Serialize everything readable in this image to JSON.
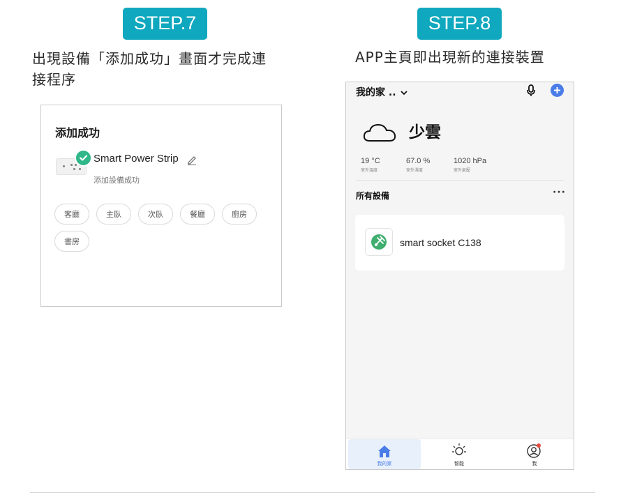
{
  "step7": {
    "badge": "STEP.7",
    "desc_line1": "出現設備「添加成功」畫面才完成連",
    "desc_line2": "接程序",
    "card": {
      "title": "添加成功",
      "device_name": "Smart Power Strip",
      "status": "添加設備成功",
      "rooms": [
        "客廳",
        "主臥",
        "次臥",
        "餐廳",
        "廚房",
        "書房"
      ]
    }
  },
  "step8": {
    "badge": "STEP.8",
    "desc": "APP主頁即出現新的連接裝置",
    "phone": {
      "home_selector": "我的家 ..",
      "weather": "少雲",
      "metrics": [
        {
          "value": "19 °C",
          "label": "室外溫度"
        },
        {
          "value": "67.0 %",
          "label": "室外濕度"
        },
        {
          "value": "1020 hPa",
          "label": "室外氣壓"
        }
      ],
      "section_title": "所有設備",
      "more": "···",
      "device": "smart socket C138",
      "tabs": [
        "我的家",
        "智能",
        "我"
      ],
      "accent": "#4a7de8"
    }
  },
  "colors": {
    "badge": "#10a8be",
    "success": "#2fb78a",
    "notification": "#e84a3c"
  }
}
